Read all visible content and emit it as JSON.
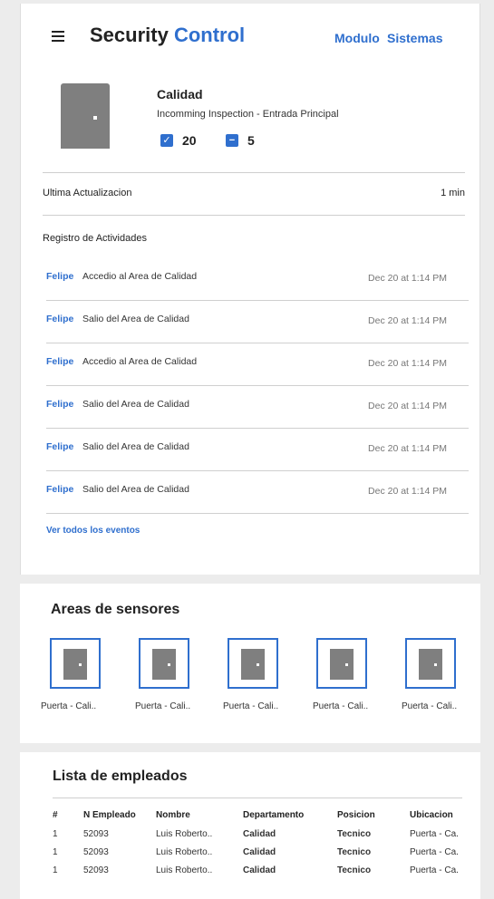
{
  "header": {
    "brand_part1": "Security",
    "brand_part2": "Control",
    "nav": [
      "Modulo",
      "Sistemas"
    ]
  },
  "area": {
    "title": "Calidad",
    "subtitle": "Incomming Inspection - Entrada Principal",
    "checked_count": "20",
    "unchecked_count": "5"
  },
  "update": {
    "label": "Ultima Actualizacion",
    "value": "1 min"
  },
  "activity": {
    "title": "Registro de Actividades",
    "rows": [
      {
        "who": "Felipe",
        "what": "Accedio al Area de Calidad",
        "when": "Dec 20 at 1:14 PM"
      },
      {
        "who": "Felipe",
        "what": "Salio del Area de Calidad",
        "when": "Dec 20 at 1:14 PM"
      },
      {
        "who": "Felipe",
        "what": "Accedio al Area de Calidad",
        "when": "Dec 20 at 1:14 PM"
      },
      {
        "who": "Felipe",
        "what": "Salio del Area de Calidad",
        "when": "Dec 20 at 1:14 PM"
      },
      {
        "who": "Felipe",
        "what": "Salio del Area de Calidad",
        "when": "Dec 20 at 1:14 PM"
      },
      {
        "who": "Felipe",
        "what": "Salio del Area de Calidad",
        "when": "Dec 20 at 1:14 PM"
      }
    ],
    "see_all": "Ver todos los eventos"
  },
  "sensors": {
    "title": "Areas de sensores",
    "items": [
      "Puerta - Cali..",
      "Puerta - Cali..",
      "Puerta - Cali..",
      "Puerta - Cali..",
      "Puerta - Cali.."
    ]
  },
  "employees": {
    "title": "Lista de empleados",
    "columns": [
      "#",
      "N Empleado",
      "Nombre",
      "Departamento",
      "Posicion",
      "Ubicacion"
    ],
    "rows": [
      [
        "1",
        "52093",
        "Luis Roberto..",
        "Calidad",
        "Tecnico",
        "Puerta - Ca."
      ],
      [
        "1",
        "52093",
        "Luis Roberto..",
        "Calidad",
        "Tecnico",
        "Puerta - Ca."
      ],
      [
        "1",
        "52093",
        "Luis Roberto..",
        "Calidad",
        "Tecnico",
        "Puerta - Ca."
      ]
    ]
  },
  "colors": {
    "accent": "#2f6fce",
    "position": "#e07a10",
    "door": "#7f7f7f"
  }
}
